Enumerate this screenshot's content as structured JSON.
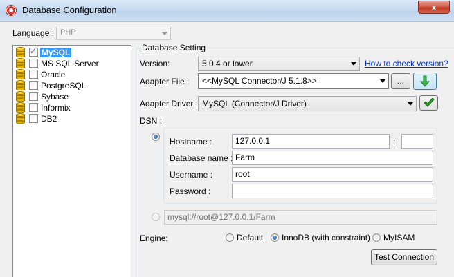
{
  "window": {
    "title": "Database Configuration",
    "close_label": "x"
  },
  "language": {
    "label": "Language :",
    "value": "PHP"
  },
  "databases": [
    {
      "label": "MySQL",
      "checked": true,
      "selected": true
    },
    {
      "label": "MS SQL Server",
      "checked": false,
      "selected": false
    },
    {
      "label": "Oracle",
      "checked": false,
      "selected": false
    },
    {
      "label": "PostgreSQL",
      "checked": false,
      "selected": false
    },
    {
      "label": "Sybase",
      "checked": false,
      "selected": false
    },
    {
      "label": "Informix",
      "checked": false,
      "selected": false
    },
    {
      "label": "DB2",
      "checked": false,
      "selected": false
    }
  ],
  "settings": {
    "legend": "Database Setting",
    "version_label": "Version:",
    "version_value": "5.0.4 or lower",
    "version_link": "How to check version?",
    "adapter_file_label": "Adapter File :",
    "adapter_file_value": "<<MySQL Connector/J 5.1.8>>",
    "browse_label": "...",
    "adapter_driver_label": "Adapter Driver :",
    "adapter_driver_value": "MySQL (Connector/J Driver)",
    "dsn_label": "DSN :",
    "hostname_label": "Hostname :",
    "hostname_value": "127.0.0.1",
    "port_sep": ":",
    "port_value": "",
    "dbname_label": "Database name :",
    "dbname_value": "Farm",
    "username_label": "Username :",
    "username_value": "root",
    "password_label": "Password :",
    "password_value": "",
    "url_value": "mysql://root@127.0.0.1/Farm",
    "engine_label": "Engine:",
    "engine_options": [
      "Default",
      "InnoDB (with constraint)",
      "MyISAM"
    ],
    "engine_selected": "InnoDB (with constraint)",
    "test_label": "Test Connection"
  },
  "colors": {
    "accent": "#3399ff",
    "link": "#0033cc",
    "green": "#2e9c2e"
  }
}
